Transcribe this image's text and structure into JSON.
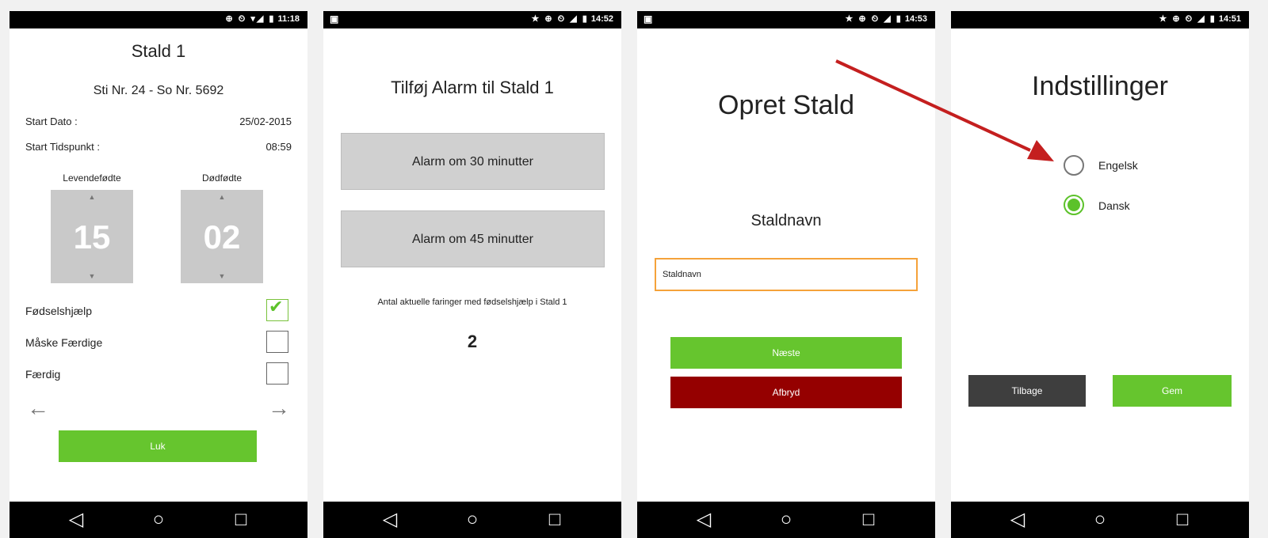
{
  "screens": [
    {
      "status": {
        "icons": "⊕ ⏲ ▾◢ ▮",
        "time": "11:18"
      },
      "title": "Stald 1",
      "subtitle": "Sti Nr. 24 - So Nr. 5692",
      "start_date_label": "Start Dato :",
      "start_date_value": "25/02-2015",
      "start_time_label": "Start Tidspunkt :",
      "start_time_value": "08:59",
      "live_label": "Levendefødte",
      "live_value": "15",
      "dead_label": "Dødfødte",
      "dead_value": "02",
      "checkboxes": [
        {
          "label": "Fødselshjælp",
          "checked": true
        },
        {
          "label": "Måske Færdige",
          "checked": false
        },
        {
          "label": "Færdig",
          "checked": false
        }
      ],
      "close_label": "Luk"
    },
    {
      "status": {
        "icons": "★ ⊕ ⏲ ◢ ▮",
        "time": "14:52"
      },
      "title": "Tilføj Alarm til Stald 1",
      "alarm_30": "Alarm om 30 minutter",
      "alarm_45": "Alarm om 45 minutter",
      "count_label": "Antal aktuelle faringer med fødselshjælp i Stald 1",
      "count_value": "2"
    },
    {
      "status": {
        "icons": "★ ⊕ ⏲ ◢ ▮",
        "time": "14:53"
      },
      "title": "Opret Stald",
      "name_label": "Staldnavn",
      "name_input_value": "Staldnavn",
      "next_label": "Næste",
      "cancel_label": "Afbryd"
    },
    {
      "status": {
        "icons": "★ ⊕ ⏲ ◢ ▮",
        "time": "14:51"
      },
      "title": "Indstillinger",
      "options": [
        {
          "label": "Engelsk",
          "selected": false
        },
        {
          "label": "Dansk",
          "selected": true
        }
      ],
      "back_label": "Tilbage",
      "save_label": "Gem"
    }
  ],
  "nav": {
    "back_glyph": "◁",
    "home_glyph": "○",
    "recent_glyph": "□"
  },
  "colors": {
    "green": "#66c52e",
    "dark_red": "#950000",
    "dark_grey": "#3e3e3e",
    "orange": "#f5a23a",
    "arrow_red": "#c41f1f"
  }
}
